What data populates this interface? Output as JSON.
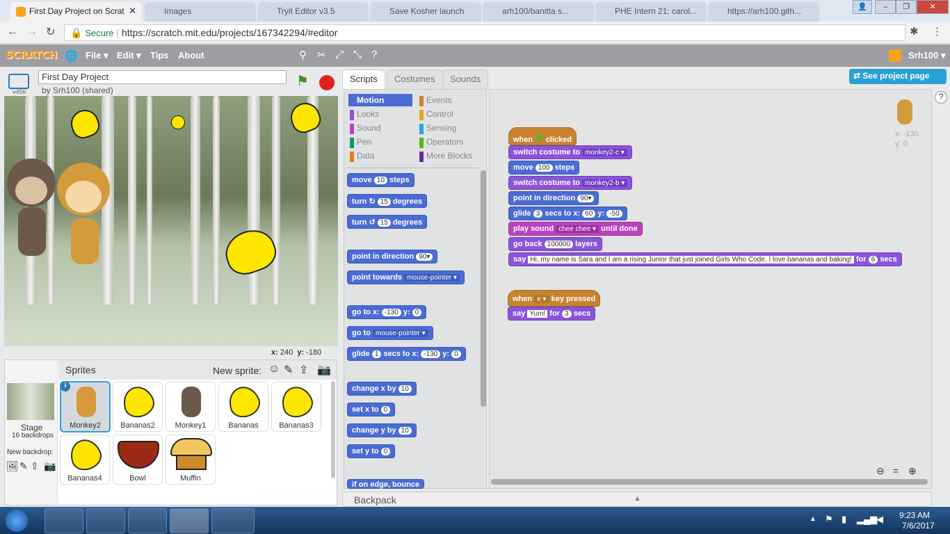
{
  "browser": {
    "tabs": [
      {
        "label": "First Day Project on Scrat",
        "active": true
      },
      {
        "label": "Images",
        "active": false
      },
      {
        "label": "Tryit Editor v3.5",
        "active": false
      },
      {
        "label": "Save Kosher launch",
        "active": false
      },
      {
        "label": "arh100/banitta s...",
        "active": false
      },
      {
        "label": "PHE Intern 21: carol...",
        "active": false
      },
      {
        "label": "https://arh100.gith...",
        "active": false
      }
    ],
    "secure_label": "Secure",
    "url": "https://scratch.mit.edu/projects/167342294/#editor"
  },
  "menubar": {
    "logo": "SCRATCH",
    "items": [
      "File ▾",
      "Edit ▾",
      "Tips",
      "About"
    ],
    "user": "Srh100 ▾",
    "see_project": "See project page"
  },
  "project": {
    "version": "v456",
    "title": "First Day Project",
    "byline": "by Srh100 (shared)",
    "stage_x_label": "x:",
    "stage_x": "240",
    "stage_y_label": "y:",
    "stage_y": "-180"
  },
  "sprites_panel": {
    "header": "Sprites",
    "new_sprite": "New sprite:",
    "stage_label": "Stage",
    "backdrops": "16 backdrops",
    "new_backdrop": "New backdrop:",
    "sprites": [
      "Monkey2",
      "Bananas2",
      "Monkey1",
      "Bananas",
      "Bananas3",
      "Bananas4",
      "Bowl",
      "Muffin"
    ],
    "selected": "Monkey2"
  },
  "editor_tabs": [
    "Scripts",
    "Costumes",
    "Sounds"
  ],
  "categories_left": [
    "Motion",
    "Looks",
    "Sound",
    "Pen",
    "Data"
  ],
  "categories_right": [
    "Events",
    "Control",
    "Sensing",
    "Operators",
    "More Blocks"
  ],
  "palette": {
    "move": [
      "move",
      "10",
      "steps"
    ],
    "turn_right": [
      "turn",
      "15",
      "degrees"
    ],
    "turn_left": [
      "turn",
      "15",
      "degrees"
    ],
    "point_dir": [
      "point in direction",
      "90▾"
    ],
    "point_towards": [
      "point towards",
      "mouse-pointer ▾"
    ],
    "goto_xy": [
      "go to x:",
      "-130",
      "y:",
      "0"
    ],
    "goto": [
      "go to",
      "mouse-pointer ▾"
    ],
    "glide": [
      "glide",
      "1",
      "secs to x:",
      "-130",
      "y:",
      "0"
    ],
    "change_x": [
      "change x by",
      "10"
    ],
    "set_x": [
      "set x to",
      "0"
    ],
    "change_y": [
      "change y by",
      "10"
    ],
    "set_y": [
      "set y to",
      "0"
    ],
    "bounce": "if on edge, bounce"
  },
  "script1": {
    "hat": [
      "when",
      "clicked"
    ],
    "b1": [
      "switch costume to",
      "monkey2-c ▾"
    ],
    "b2": [
      "move",
      "100",
      "steps"
    ],
    "b3": [
      "switch costume to",
      "monkey2-b ▾"
    ],
    "b4": [
      "point in direction",
      "90▾"
    ],
    "b5": [
      "glide",
      "3",
      "secs to x:",
      "60",
      "y:",
      "-50"
    ],
    "b6": [
      "play sound",
      "chee chee ▾",
      "until done"
    ],
    "b7": [
      "go back",
      "100000",
      "layers"
    ],
    "b8": [
      "say",
      "Hi, my name is Sara and I am a rising Junior that just joined Girls Who Code.  I love bananas and baking!",
      "for",
      "6",
      "secs"
    ]
  },
  "script2": {
    "hat": [
      "when",
      "e ▾",
      "key pressed"
    ],
    "b1": [
      "say",
      "Yum!",
      "for",
      "3",
      "secs"
    ]
  },
  "sprite_info": {
    "x": "x: -130",
    "y": "y: 0"
  },
  "backpack": "Backpack",
  "taskbar": {
    "time": "9:23 AM",
    "date": "7/6/2017"
  }
}
